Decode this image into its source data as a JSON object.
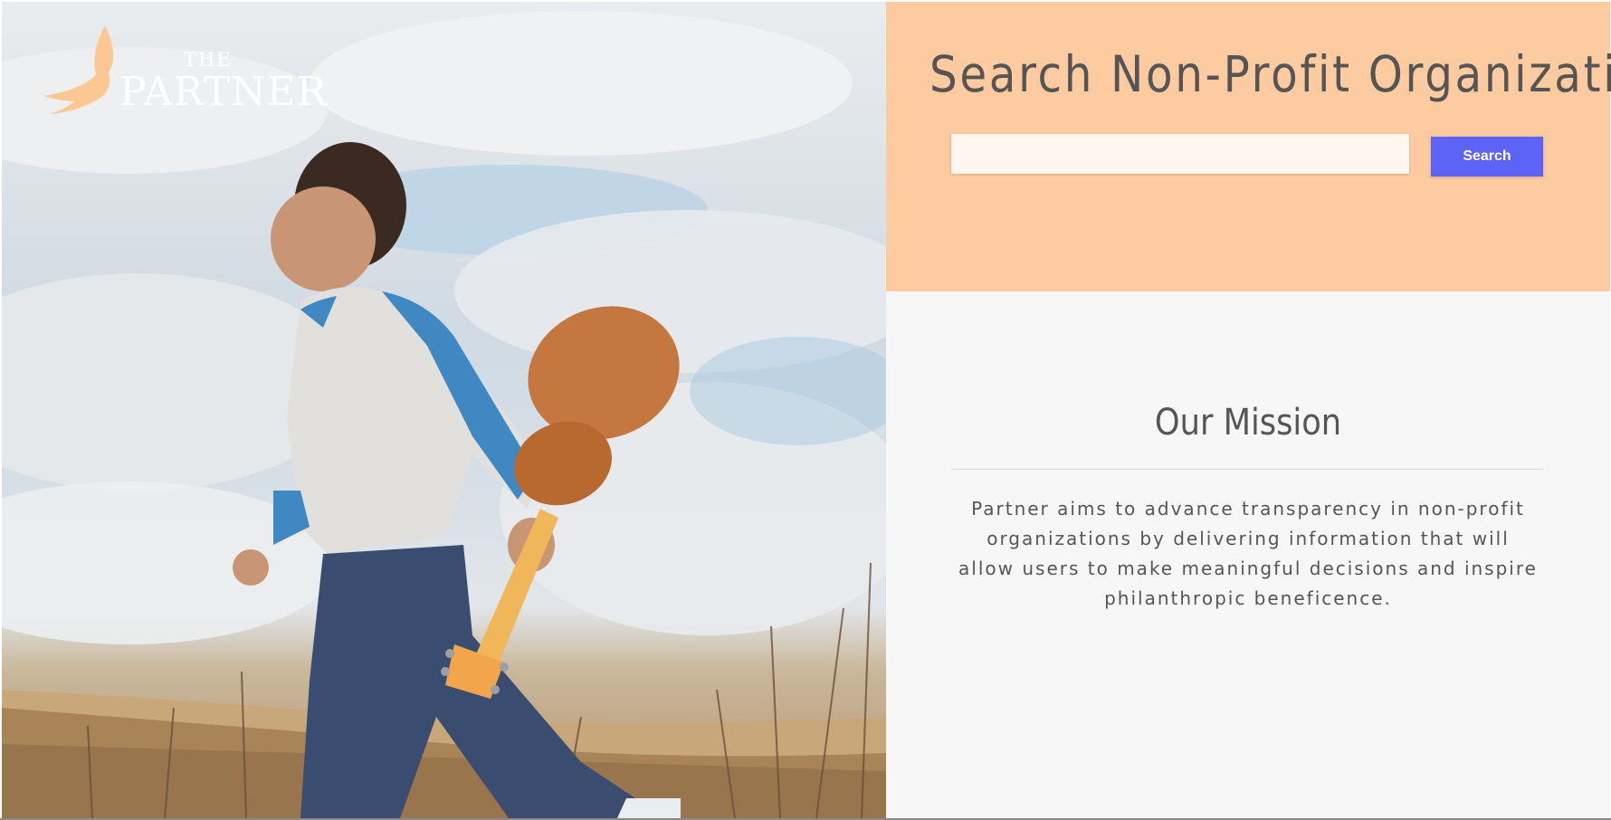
{
  "brand": {
    "logo_the": "THE",
    "logo_partner": "PARTNER",
    "logo_color": "#ffffff",
    "bird_color": "#fbc894"
  },
  "search": {
    "title": "Search Non-Profit Organization",
    "input_value": "",
    "input_placeholder": "",
    "button_label": "Search",
    "panel_color": "#fecba0",
    "button_color": "#5c63f6"
  },
  "mission": {
    "title": "Our Mission",
    "body": "Partner aims to advance transparency in non-profit organizations by delivering information that will allow users to make meaningful decisions and inspire philanthropic beneficence."
  },
  "hero": {
    "image_icon": "boy-with-ukulele-photo"
  }
}
